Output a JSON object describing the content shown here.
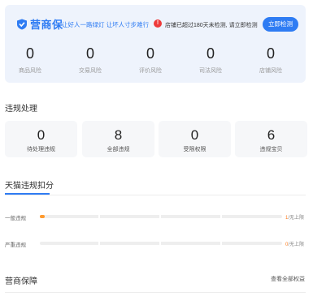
{
  "header": {
    "brand_name": "营商保",
    "slogan": "让好人一路绿灯 让坏人寸步难行",
    "warning_text": "店铺已超过180天未检测, 请立即检测",
    "check_button": "立即检测",
    "stats": [
      {
        "value": "0",
        "label": "商品风险"
      },
      {
        "value": "0",
        "label": "交易风险"
      },
      {
        "value": "0",
        "label": "评价风险"
      },
      {
        "value": "0",
        "label": "司法风险"
      },
      {
        "value": "0",
        "label": "店铺风险"
      }
    ]
  },
  "violation": {
    "title": "违规处理",
    "cards": [
      {
        "value": "0",
        "label": "待处理违规"
      },
      {
        "value": "8",
        "label": "全部违规"
      },
      {
        "value": "0",
        "label": "受限权限"
      },
      {
        "value": "6",
        "label": "违规宝贝"
      }
    ]
  },
  "deduction": {
    "tab_label": "天猫违规扣分",
    "rows": [
      {
        "label": "一般违规",
        "current": "1",
        "suffix": "/无上限",
        "progress": 0.02
      },
      {
        "label": "严重违规",
        "current": "0",
        "suffix": "/无上限",
        "progress": 0
      }
    ]
  },
  "guarantee": {
    "title": "营商保障",
    "link": "查看全部权益"
  },
  "colors": {
    "accent": "#2f7cf3",
    "warning": "#ee3a3a",
    "progress": "#ff9a2e"
  }
}
